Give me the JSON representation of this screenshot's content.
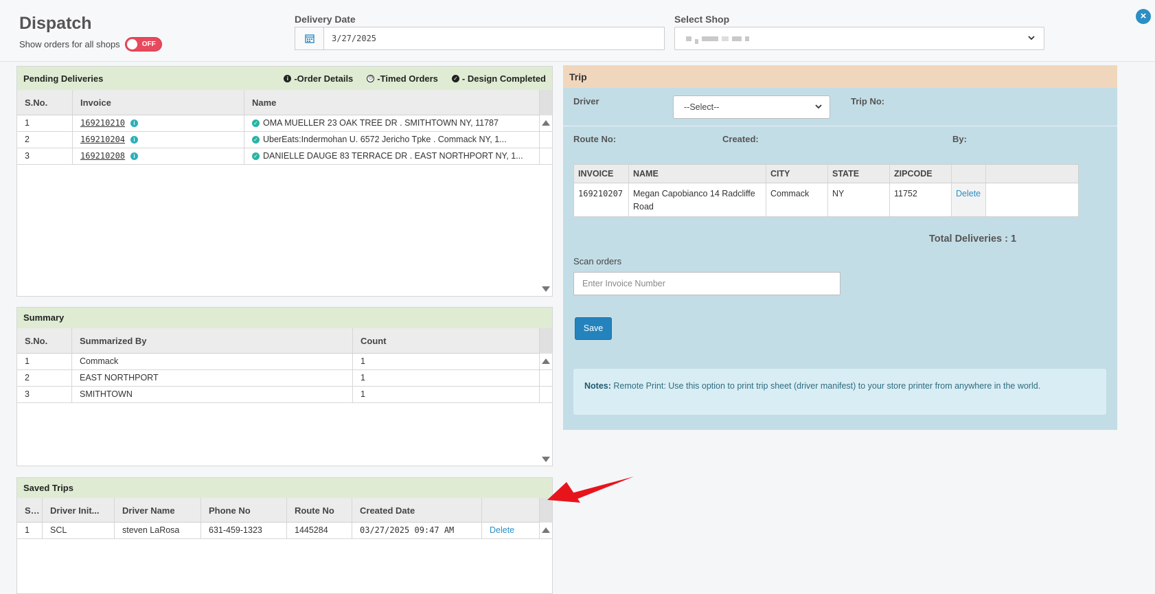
{
  "header": {
    "title": "Dispatch",
    "toggle_label": "Show orders for all shops",
    "toggle_state": "OFF",
    "delivery_date_label": "Delivery Date",
    "delivery_date_value": "3/27/2025",
    "select_shop_label": "Select Shop"
  },
  "pending": {
    "title": "Pending Deliveries",
    "legend": {
      "order_details": "-Order Details",
      "timed_orders": "-Timed Orders",
      "design_completed": "- Design Completed"
    },
    "columns": [
      "S.No.",
      "Invoice",
      "Name"
    ],
    "rows": [
      {
        "sno": "1",
        "invoice": "169210210",
        "name": "OMA MUELLER 23 OAK TREE DR . SMITHTOWN NY, 11787"
      },
      {
        "sno": "2",
        "invoice": "169210204",
        "name": "UberEats:Indermohan U. 6572 Jericho Tpke . Commack NY, 1..."
      },
      {
        "sno": "3",
        "invoice": "169210208",
        "name": "DANIELLE DAUGE 83 TERRACE DR . EAST NORTHPORT NY, 1..."
      }
    ]
  },
  "summary": {
    "title": "Summary",
    "columns": [
      "S.No.",
      "Summarized By",
      "Count"
    ],
    "rows": [
      {
        "sno": "1",
        "by": "Commack",
        "count": "1"
      },
      {
        "sno": "2",
        "by": "EAST NORTHPORT",
        "count": "1"
      },
      {
        "sno": "3",
        "by": "SMITHTOWN",
        "count": "1"
      }
    ]
  },
  "saved_trips": {
    "title": "Saved Trips",
    "columns": [
      "S...",
      "Driver Init...",
      "Driver Name",
      "Phone No",
      "Route No",
      "Created Date"
    ],
    "rows": [
      {
        "sno": "1",
        "initials": "SCL",
        "driver": "steven LaRosa",
        "phone": "631-459-1323",
        "route": "1445284",
        "created": "03/27/2025 09:47 AM",
        "action": "Delete"
      }
    ]
  },
  "trip": {
    "title": "Trip",
    "driver_label": "Driver",
    "driver_value": "--Select--",
    "trip_no_label": "Trip No:",
    "route_no_label": "Route No:",
    "created_label": "Created:",
    "by_label": "By:",
    "columns": [
      "INVOICE",
      "NAME",
      "CITY",
      "STATE",
      "ZIPCODE"
    ],
    "rows": [
      {
        "invoice": "169210207",
        "name": "Megan Capobianco 14 Radcliffe Road",
        "city": "Commack",
        "state": "NY",
        "zip": "11752",
        "action": "Delete"
      }
    ],
    "total": "Total Deliveries : 1",
    "scan_label": "Scan orders",
    "scan_placeholder": "Enter Invoice Number",
    "save_label": "Save",
    "notes_label": "Notes:",
    "notes_text": " Remote Print: Use this option to print trip sheet (driver manifest) to your store printer from anywhere in the world."
  },
  "colors": {
    "accent": "#2483bd",
    "panel_head": "#dfecd3",
    "trip_head": "#f0d6bd",
    "trip_bg": "#c3dde6",
    "toggle_off": "#e8495c",
    "arrow": "#e8141c"
  }
}
